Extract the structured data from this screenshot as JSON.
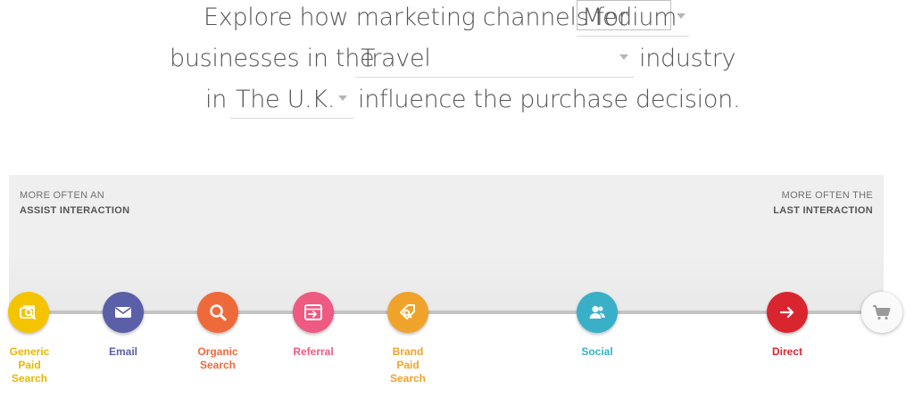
{
  "sentence": {
    "line1_prefix": "Explore how marketing channels for",
    "line2_prefix": "businesses in the",
    "line2_suffix": "industry",
    "line3_prefix": "in",
    "line3_suffix": "influence the purchase decision."
  },
  "selectors": {
    "business_size": "Medium",
    "industry": "Travel",
    "country": "The U.K."
  },
  "panel": {
    "left_top": "MORE OFTEN AN",
    "left_bold": "ASSIST INTERACTION",
    "right_top": "MORE OFTEN THE",
    "right_bold": "LAST INTERACTION"
  },
  "channels": [
    {
      "label_lines": [
        "Generic",
        "Paid",
        "Search"
      ],
      "color": "#f5c400",
      "icon": "generic-paid-search-icon"
    },
    {
      "label_lines": [
        "Email"
      ],
      "color": "#5b5fa8",
      "icon": "email-icon"
    },
    {
      "label_lines": [
        "Organic",
        "Search"
      ],
      "color": "#ef6a3b",
      "icon": "magnifier-icon"
    },
    {
      "label_lines": [
        "Referral"
      ],
      "color": "#ee5a82",
      "icon": "referral-icon"
    },
    {
      "label_lines": [
        "Brand",
        "Paid",
        "Search"
      ],
      "color": "#f0a32a",
      "icon": "brand-tag-icon"
    },
    {
      "label_lines": [
        "Social"
      ],
      "color": "#3ab0c8",
      "icon": "people-icon"
    },
    {
      "label_lines": [
        "Direct"
      ],
      "color": "#d9262e",
      "icon": "arrow-right-icon"
    }
  ],
  "end_icon": "shopping-cart-icon"
}
